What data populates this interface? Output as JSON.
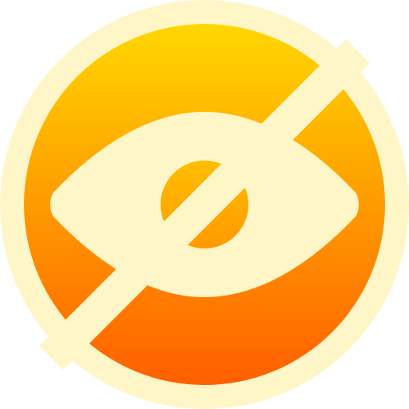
{
  "icon": {
    "name": "eye-slash-icon",
    "colors": {
      "outer_ring": "#fff6c8",
      "gradient_top": "#ffd700",
      "gradient_bottom": "#ff5f00",
      "eye_shape": "#fff6c8",
      "pupil_top": "#ffbe00",
      "pupil_bottom": "#ff9900",
      "slash": "#fff6c8"
    }
  }
}
